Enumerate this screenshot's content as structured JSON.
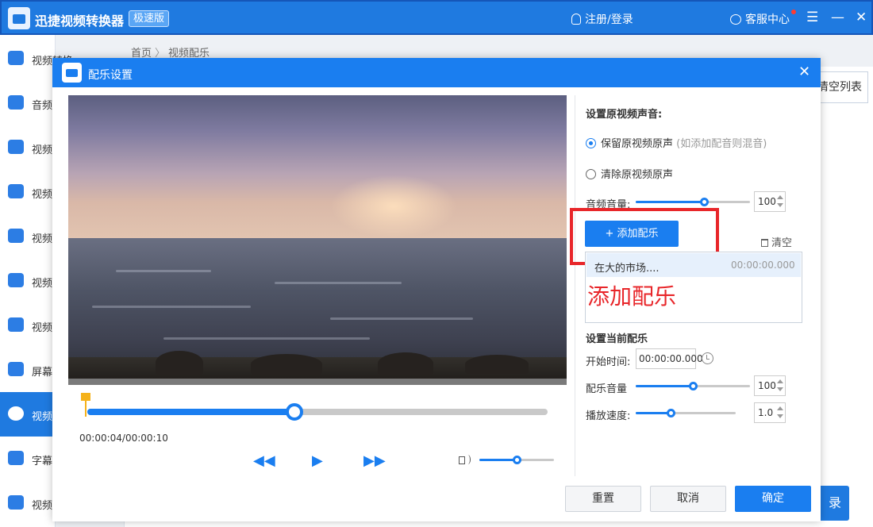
{
  "app": {
    "title": "迅捷视频转换器",
    "badge": "极速版",
    "login": "注册/登录",
    "support": "客服中心",
    "menu_glyph": "☰",
    "minimize_glyph": "—",
    "close_glyph": "✕",
    "clear_list": "清空列表",
    "convert_partial": "录"
  },
  "sidebar": {
    "items": [
      {
        "label": "视频转换"
      },
      {
        "label": "音频"
      },
      {
        "label": "视频"
      },
      {
        "label": "视频"
      },
      {
        "label": "视频"
      },
      {
        "label": "视频"
      },
      {
        "label": "视频"
      },
      {
        "label": "屏幕"
      },
      {
        "label": "视频"
      },
      {
        "label": "字幕"
      },
      {
        "label": "视频"
      }
    ]
  },
  "breadcrumb": {
    "home": "首页",
    "separator": "〉",
    "current": "视频配乐"
  },
  "dialog": {
    "title": "配乐设置",
    "close_glyph": "✕",
    "player": {
      "time": "00:00:04/00:00:10",
      "progress": 0.45,
      "volume_level": 0.5,
      "rewind_glyph": "◀◀",
      "play_glyph": "▶",
      "forward_glyph": "▶▶"
    },
    "original_audio": {
      "title": "设置原视频声音:",
      "keep_label": "保留原视频原声",
      "keep_hint": "(如添加配音则混音)",
      "clear_label": "清除原视频原声",
      "volume_label": "音频音量:",
      "volume_value": "100",
      "volume_level": 0.6
    },
    "music": {
      "add_button": "+ 添加配乐",
      "clear_label": "清空",
      "list": [
        {
          "name": "在大的市场....",
          "time": "00:00:00.000"
        }
      ],
      "annotation": "添加配乐"
    },
    "current_music": {
      "title": "设置当前配乐",
      "start_label": "开始时间:",
      "start_value": "00:00:00.000",
      "volume_label": "配乐音量",
      "volume_value": "100",
      "volume_level": 0.5,
      "speed_label": "播放速度:",
      "speed_value": "1.0",
      "speed_level": 0.35
    },
    "buttons": {
      "reset": "重置",
      "cancel": "取消",
      "ok": "确定"
    }
  },
  "colors": {
    "primary": "#1a7ef0",
    "annotation_red": "#e8262a"
  }
}
